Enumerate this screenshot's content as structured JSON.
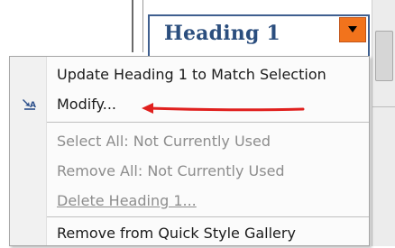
{
  "style_gallery": {
    "selected_style": "Heading 1",
    "dropdown_icon": "chevron-down-icon"
  },
  "context_menu": {
    "items": [
      {
        "label": "Update Heading 1 to Match Selection",
        "enabled": true
      },
      {
        "label": "Modify...",
        "enabled": true,
        "icon": "modify-style-icon"
      },
      {
        "label": "Select All: Not Currently Used",
        "enabled": false
      },
      {
        "label": "Remove All: Not Currently Used",
        "enabled": false
      },
      {
        "label": "Delete Heading 1...",
        "enabled": false
      },
      {
        "label": "Remove from Quick Style Gallery",
        "enabled": true
      }
    ]
  },
  "colors": {
    "heading_text": "#2b4e7e",
    "dropdown_button": "#f2731c",
    "annotation_arrow": "#e0201e"
  }
}
